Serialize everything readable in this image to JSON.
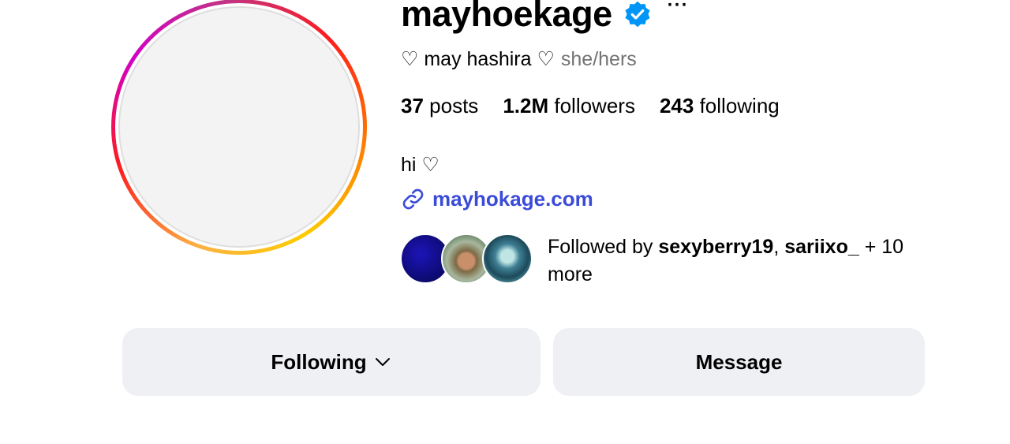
{
  "profile": {
    "username": "mayhoekage",
    "verified": true,
    "more_label": "···",
    "fullname": "♡ may hashira ♡",
    "pronouns": "she/hers",
    "bio": "hi ♡",
    "link": "mayhokage.com",
    "avatar_icon": "profile-photo"
  },
  "stats": {
    "posts_count": "37",
    "posts_label": "posts",
    "followers_count": "1.2M",
    "followers_label": "followers",
    "following_count": "243",
    "following_label": "following"
  },
  "followed_by": {
    "prefix": "Followed by",
    "user1": "sexyberry19",
    "separator": ",",
    "user2": "sariixo_",
    "suffix": "+ 10 more"
  },
  "actions": {
    "following_label": "Following",
    "message_label": "Message"
  },
  "colors": {
    "link": "#3a4bd8",
    "verified": "#0095f6",
    "button_bg": "#eff0f4",
    "muted": "#737373"
  }
}
